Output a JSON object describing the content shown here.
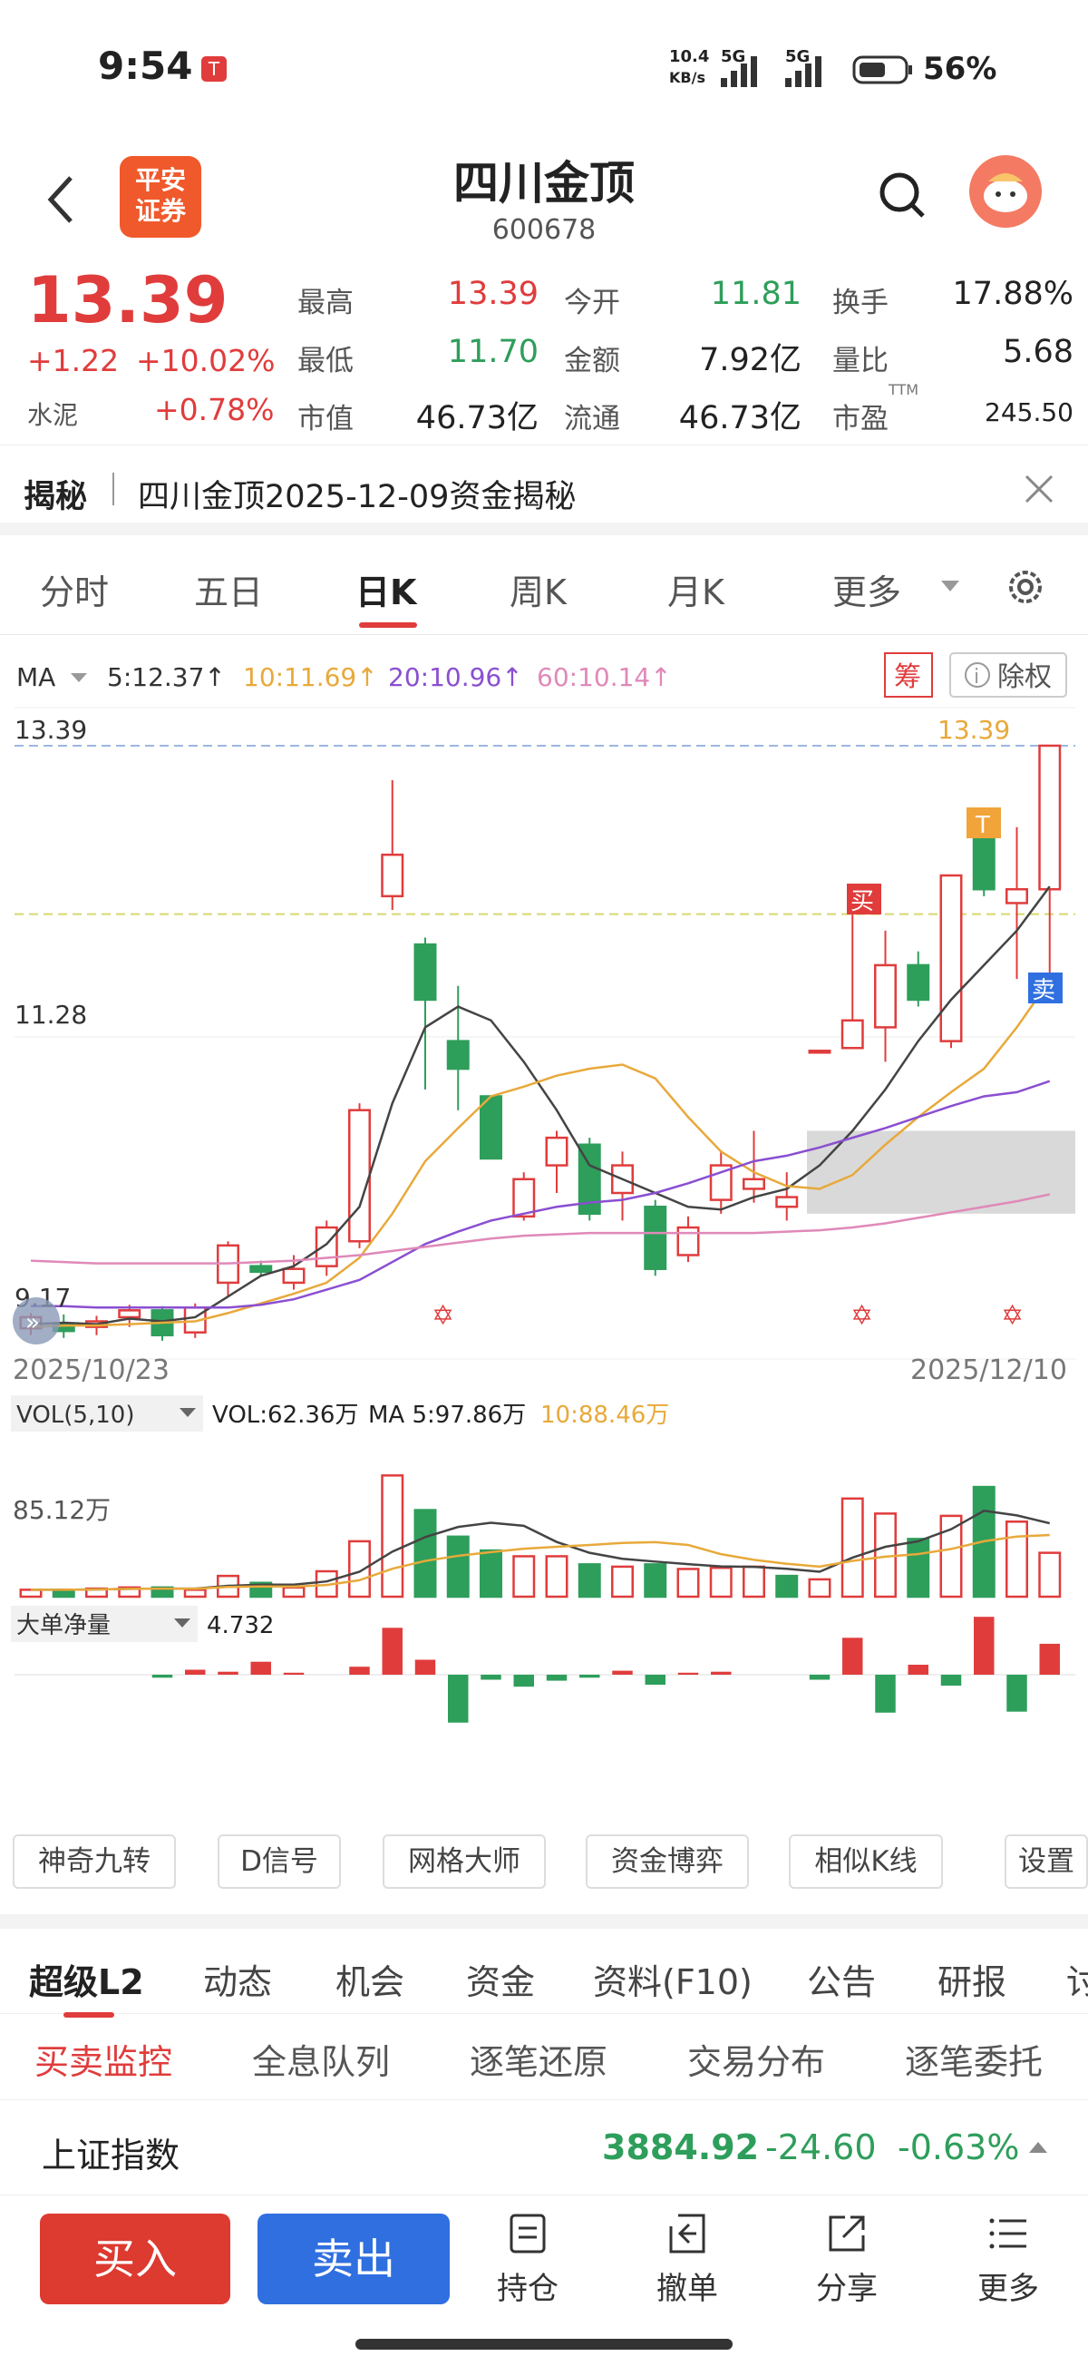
{
  "status": {
    "time": "9:54",
    "net_speed_top": "10.4",
    "net_speed_bot": "KB/s",
    "sig1": "5G",
    "sig2": "5G",
    "battery": "56%"
  },
  "header": {
    "broker_line1": "平安",
    "broker_line2": "证券",
    "name": "四川金顶",
    "code": "600678"
  },
  "quote": {
    "price": "13.39",
    "change": "+1.22",
    "change_pct": "+10.02%",
    "sector": "水泥",
    "sector_pct": "+0.78%",
    "rows": [
      [
        "最高",
        "13.39",
        "今开",
        "11.81",
        "换手",
        "17.88%"
      ],
      [
        "最低",
        "11.70",
        "金额",
        "7.92亿",
        "量比",
        "5.68"
      ],
      [
        "市值",
        "46.73亿",
        "流通",
        "46.73亿",
        "市盈",
        "245.50"
      ]
    ],
    "ttm": "TTM"
  },
  "jiemi": {
    "label": "揭秘",
    "text": "四川金顶2025-12-09资金揭秘"
  },
  "period_tabs": [
    "分时",
    "五日",
    "日K",
    "周K",
    "月K",
    "更多"
  ],
  "ma_bar": {
    "label": "MA",
    "ma5": "5:12.37↑",
    "ma10": "10:11.69↑",
    "ma20": "20:10.96↑",
    "ma60": "60:10.14↑",
    "chip": "筹",
    "fuquan": "除权"
  },
  "chart_data": {
    "type": "candlestick",
    "dates": [
      "2025/10/23",
      "2025/12/10"
    ],
    "y_labels": [
      "13.39",
      "11.28",
      "9.17"
    ],
    "price_tag": "13.39",
    "markers": {
      "buy": "买",
      "sell": "卖",
      "t": "T"
    },
    "candles": [
      [
        9.17,
        9.25,
        9.12,
        9.28
      ],
      [
        9.2,
        9.15,
        9.1,
        9.27
      ],
      [
        9.18,
        9.22,
        9.12,
        9.26
      ],
      [
        9.25,
        9.3,
        9.18,
        9.34
      ],
      [
        9.3,
        9.12,
        9.08,
        9.33
      ],
      [
        9.14,
        9.32,
        9.1,
        9.35
      ],
      [
        9.5,
        9.77,
        9.4,
        9.8
      ],
      [
        9.62,
        9.58,
        9.55,
        9.66
      ],
      [
        9.5,
        9.6,
        9.45,
        9.7
      ],
      [
        9.62,
        9.9,
        9.55,
        9.95
      ],
      [
        9.8,
        10.75,
        9.75,
        10.8
      ],
      [
        12.3,
        12.6,
        12.2,
        13.14
      ],
      [
        11.95,
        11.55,
        10.9,
        12.0
      ],
      [
        11.25,
        11.05,
        10.75,
        11.65
      ],
      [
        10.85,
        10.4,
        10.4,
        10.85
      ],
      [
        9.98,
        10.25,
        9.95,
        10.3
      ],
      [
        10.35,
        10.55,
        10.15,
        10.6
      ],
      [
        10.5,
        10.0,
        9.95,
        10.55
      ],
      [
        10.15,
        10.35,
        9.95,
        10.45
      ],
      [
        10.05,
        9.6,
        9.55,
        10.1
      ],
      [
        9.7,
        9.9,
        9.65,
        9.98
      ],
      [
        10.1,
        10.35,
        10.0,
        10.45
      ],
      [
        10.18,
        10.25,
        10.08,
        10.6
      ],
      [
        10.05,
        10.12,
        9.95,
        10.3
      ],
      [
        11.18,
        11.18,
        11.18,
        11.18
      ],
      [
        11.2,
        11.4,
        11.2,
        12.25
      ],
      [
        11.35,
        11.8,
        11.1,
        12.05
      ],
      [
        11.8,
        11.55,
        11.5,
        11.9
      ],
      [
        11.25,
        12.45,
        11.2,
        12.45
      ],
      [
        12.9,
        12.35,
        12.3,
        12.9
      ],
      [
        12.25,
        12.35,
        11.7,
        12.8
      ],
      [
        12.35,
        13.39,
        11.7,
        13.39
      ]
    ],
    "ma5": [
      9.2,
      9.21,
      9.2,
      9.24,
      9.22,
      9.25,
      9.4,
      9.55,
      9.62,
      9.78,
      10.05,
      10.8,
      11.35,
      11.5,
      11.4,
      11.1,
      10.75,
      10.35,
      10.25,
      10.15,
      10.05,
      10.03,
      10.12,
      10.18,
      10.35,
      10.6,
      10.9,
      11.25,
      11.55,
      11.8,
      12.05,
      12.37
    ],
    "ma10": [
      9.18,
      9.19,
      9.19,
      9.2,
      9.21,
      9.22,
      9.28,
      9.35,
      9.42,
      9.5,
      9.68,
      10.0,
      10.38,
      10.62,
      10.85,
      10.92,
      11.0,
      11.05,
      11.08,
      10.98,
      10.7,
      10.45,
      10.3,
      10.2,
      10.18,
      10.28,
      10.5,
      10.7,
      10.88,
      11.05,
      11.35,
      11.69
    ],
    "ma20": [
      9.33,
      9.33,
      9.32,
      9.32,
      9.32,
      9.32,
      9.32,
      9.34,
      9.38,
      9.45,
      9.52,
      9.65,
      9.78,
      9.87,
      9.95,
      10.0,
      10.05,
      10.08,
      10.1,
      10.15,
      10.22,
      10.3,
      10.38,
      10.42,
      10.48,
      10.55,
      10.62,
      10.7,
      10.78,
      10.85,
      10.88,
      10.96
    ],
    "ma60": [
      9.66,
      9.65,
      9.64,
      9.64,
      9.64,
      9.64,
      9.64,
      9.65,
      9.66,
      9.68,
      9.7,
      9.73,
      9.76,
      9.79,
      9.82,
      9.84,
      9.85,
      9.86,
      9.86,
      9.86,
      9.86,
      9.86,
      9.86,
      9.87,
      9.88,
      9.9,
      9.93,
      9.97,
      10.01,
      10.05,
      10.09,
      10.14
    ],
    "vol_bar": {
      "label": "VOL(5,10)",
      "vol": "VOL:62.36万",
      "ma5": "MA 5:97.86万",
      "ma10": "10:88.46万",
      "axis": "85.12万"
    },
    "volumes": [
      6,
      6,
      7,
      8,
      8,
      6,
      18,
      12,
      8,
      22,
      48,
      105,
      75,
      52,
      40,
      35,
      35,
      28,
      26,
      28,
      24,
      25,
      26,
      18,
      15,
      85,
      72,
      50,
      70,
      95,
      65,
      38
    ],
    "vol_up": [
      1,
      0,
      1,
      1,
      0,
      1,
      1,
      0,
      1,
      1,
      1,
      1,
      0,
      0,
      0,
      1,
      1,
      0,
      1,
      0,
      1,
      1,
      1,
      0,
      1,
      1,
      1,
      0,
      1,
      0,
      1,
      1
    ],
    "flow_bar": {
      "label": "大单净量",
      "value": "4.732"
    },
    "flows": [
      0,
      0,
      0,
      0,
      -0.3,
      0.5,
      0.3,
      1.3,
      0.2,
      0,
      0.8,
      4.7,
      1.5,
      -4.8,
      -0.5,
      -1.2,
      -0.6,
      -0.3,
      0.4,
      -1.0,
      0.2,
      0.3,
      0,
      0,
      -0.5,
      3.7,
      -3.8,
      1.0,
      -1.1,
      5.8,
      -3.7,
      3.1
    ]
  },
  "tools": [
    "神奇九转",
    "D信号",
    "网格大师",
    "资金博弈",
    "相似K线",
    "设置"
  ],
  "main_tabs": [
    "超级L2",
    "动态",
    "机会",
    "资金",
    "资料(F10)",
    "公告",
    "研报",
    "讨"
  ],
  "sub_tabs": [
    "买卖监控",
    "全息队列",
    "逐笔还原",
    "交易分布",
    "逐笔委托"
  ],
  "index": {
    "name": "上证指数",
    "value": "3884.92",
    "change": "-24.60",
    "pct": "-0.63%"
  },
  "bottom": {
    "buy": "买入",
    "sell": "卖出",
    "icons": [
      "持仓",
      "撤单",
      "分享",
      "更多"
    ]
  },
  "colors": {
    "up": "#e03c3c",
    "down": "#2e9e5b",
    "blue": "#2f6fe0",
    "ma5": "#444444",
    "ma10": "#e8a93a",
    "ma20": "#8a4fd1",
    "ma60": "#e089b9"
  }
}
